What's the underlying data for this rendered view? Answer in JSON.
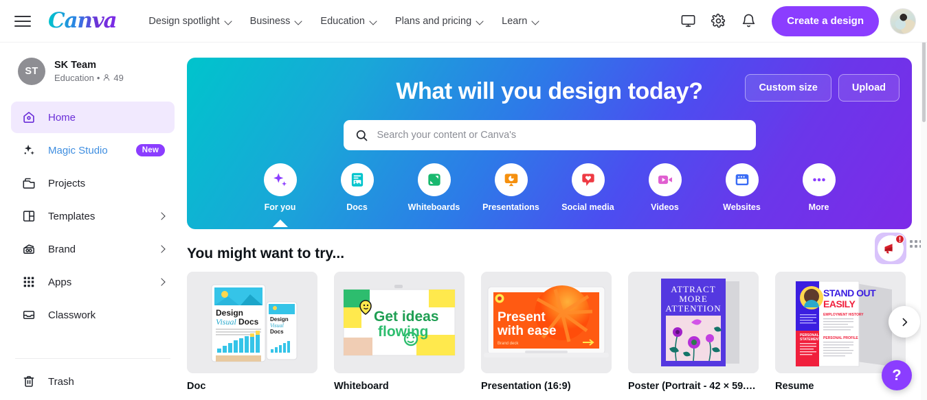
{
  "header": {
    "menu_icon": "hamburger-icon",
    "logo_text": "Canva",
    "nav": [
      {
        "label": "Design spotlight"
      },
      {
        "label": "Business"
      },
      {
        "label": "Education"
      },
      {
        "label": "Plans and pricing"
      },
      {
        "label": "Learn"
      }
    ],
    "icons": [
      {
        "name": "display-icon"
      },
      {
        "name": "gear-icon"
      },
      {
        "name": "bell-icon"
      }
    ],
    "create_button": "Create a design",
    "avatar": "user-avatar"
  },
  "sidebar": {
    "team": {
      "initials": "ST",
      "name": "SK Team",
      "type": "Education",
      "separator": "•",
      "member_count": "49"
    },
    "items": [
      {
        "label": "Home",
        "icon": "home-icon",
        "active": true,
        "chevron": false,
        "badge": ""
      },
      {
        "label": "Magic Studio",
        "icon": "sparkle-icon",
        "active": false,
        "chevron": false,
        "badge": "New"
      },
      {
        "label": "Projects",
        "icon": "folder-icon",
        "active": false,
        "chevron": false,
        "badge": ""
      },
      {
        "label": "Templates",
        "icon": "templates-icon",
        "active": false,
        "chevron": true,
        "badge": ""
      },
      {
        "label": "Brand",
        "icon": "brand-icon",
        "active": false,
        "chevron": true,
        "badge": ""
      },
      {
        "label": "Apps",
        "icon": "apps-grid-icon",
        "active": false,
        "chevron": true,
        "badge": ""
      },
      {
        "label": "Classwork",
        "icon": "classwork-tray-icon",
        "active": false,
        "chevron": false,
        "badge": ""
      }
    ],
    "trash": {
      "label": "Trash",
      "icon": "trash-icon"
    }
  },
  "hero": {
    "title": "What will you design today?",
    "custom_size_button": "Custom size",
    "upload_button": "Upload",
    "search": {
      "placeholder": "Search your content or Canva's",
      "value": "",
      "icon": "search-icon"
    },
    "categories": [
      {
        "label": "For you",
        "icon": "sparkles-icon",
        "color": "#8b3dff",
        "active": true
      },
      {
        "label": "Docs",
        "icon": "doc-icon",
        "color": "#00c4cc",
        "active": false
      },
      {
        "label": "Whiteboards",
        "icon": "whiteboard-icon",
        "color": "#19b86e",
        "active": false
      },
      {
        "label": "Presentations",
        "icon": "presentation-icon",
        "color": "#f5900e",
        "active": false
      },
      {
        "label": "Social media",
        "icon": "heart-bubble-icon",
        "color": "#ee3a43",
        "active": false
      },
      {
        "label": "Videos",
        "icon": "video-camera-icon",
        "color": "#e05fd0",
        "active": false
      },
      {
        "label": "Websites",
        "icon": "website-window-icon",
        "color": "#3b6df5",
        "active": false
      },
      {
        "label": "More",
        "icon": "ellipsis-icon",
        "color": "#8b3dff",
        "active": false
      }
    ],
    "gradient_start": "#00c4cc",
    "gradient_end": "#7d2ae8"
  },
  "suggestions": {
    "heading": "You might want to try...",
    "cards": [
      {
        "label": "Doc",
        "thumb": "doc-template-thumbnail",
        "thumb_text": "Design Visual Docs"
      },
      {
        "label": "Whiteboard",
        "thumb": "whiteboard-template-thumbnail",
        "thumb_text": "Get ideas flowing"
      },
      {
        "label": "Presentation (16:9)",
        "thumb": "presentation-template-thumbnail",
        "thumb_text": "Present with ease"
      },
      {
        "label": "Poster (Portrait - 42 × 59.4 ...",
        "thumb": "poster-template-thumbnail",
        "thumb_text": "ATTRACT MORE ATTENTION"
      },
      {
        "label": "Resume",
        "thumb": "resume-template-thumbnail",
        "thumb_text": "STAND OUT EASILY"
      }
    ],
    "next_arrow": "chevron-right-icon"
  },
  "floating": {
    "promo": {
      "icon": "announcement-megaphone-icon",
      "alert": "!"
    },
    "drag_handle": "drag-handle-icon",
    "help_button": "?"
  }
}
